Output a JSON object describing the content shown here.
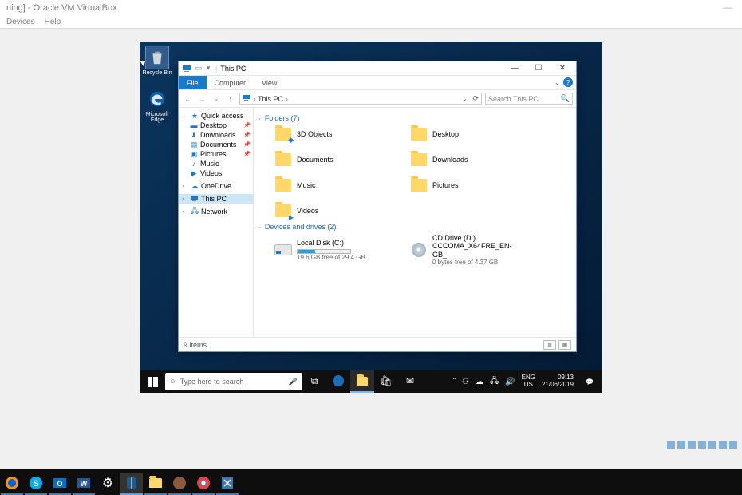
{
  "vbox": {
    "title": "ning] - Oracle VM VirtualBox",
    "menu": [
      "Devices",
      "Help"
    ]
  },
  "desktop": {
    "icons": [
      {
        "name": "recycle-bin",
        "label": "Recycle Bin"
      },
      {
        "name": "edge",
        "label": "Microsoft\nEdge"
      }
    ]
  },
  "explorer": {
    "title": "This PC",
    "ribbon": {
      "tabs": [
        "File",
        "Computer",
        "View"
      ],
      "active": 0
    },
    "breadcrumb": [
      "This PC"
    ],
    "search_placeholder": "Search This PC",
    "sidebar": {
      "quick": {
        "label": "Quick access",
        "items": [
          {
            "label": "Desktop",
            "pin": true,
            "ico": "desktop"
          },
          {
            "label": "Downloads",
            "pin": true,
            "ico": "downloads"
          },
          {
            "label": "Documents",
            "pin": true,
            "ico": "documents"
          },
          {
            "label": "Pictures",
            "pin": true,
            "ico": "pictures"
          },
          {
            "label": "Music",
            "pin": false,
            "ico": "music"
          },
          {
            "label": "Videos",
            "pin": false,
            "ico": "videos"
          }
        ]
      },
      "onedrive": {
        "label": "OneDrive"
      },
      "thispc": {
        "label": "This PC",
        "selected": true
      },
      "network": {
        "label": "Network"
      }
    },
    "groups": {
      "folders": {
        "header": "Folders (7)",
        "items": [
          {
            "label": "3D Objects"
          },
          {
            "label": "Desktop"
          },
          {
            "label": "Documents"
          },
          {
            "label": "Downloads"
          },
          {
            "label": "Music"
          },
          {
            "label": "Pictures"
          },
          {
            "label": "Videos"
          }
        ]
      },
      "drives": {
        "header": "Devices and drives (2)",
        "items": [
          {
            "label": "Local Disk (C:)",
            "sub": "19.6 GB free of 29.4 GB",
            "type": "hdd",
            "fill_pct": 33
          },
          {
            "label": "CD Drive (D:) CCCOMA_X64FRE_EN-GB_",
            "sub": "0 bytes free of 4.37 GB",
            "type": "cd"
          }
        ]
      }
    },
    "status": "9 items"
  },
  "guest_taskbar": {
    "search_placeholder": "Type here to search",
    "lang1": "ENG",
    "lang2": "US",
    "time": "09:13",
    "date": "21/06/2019"
  }
}
